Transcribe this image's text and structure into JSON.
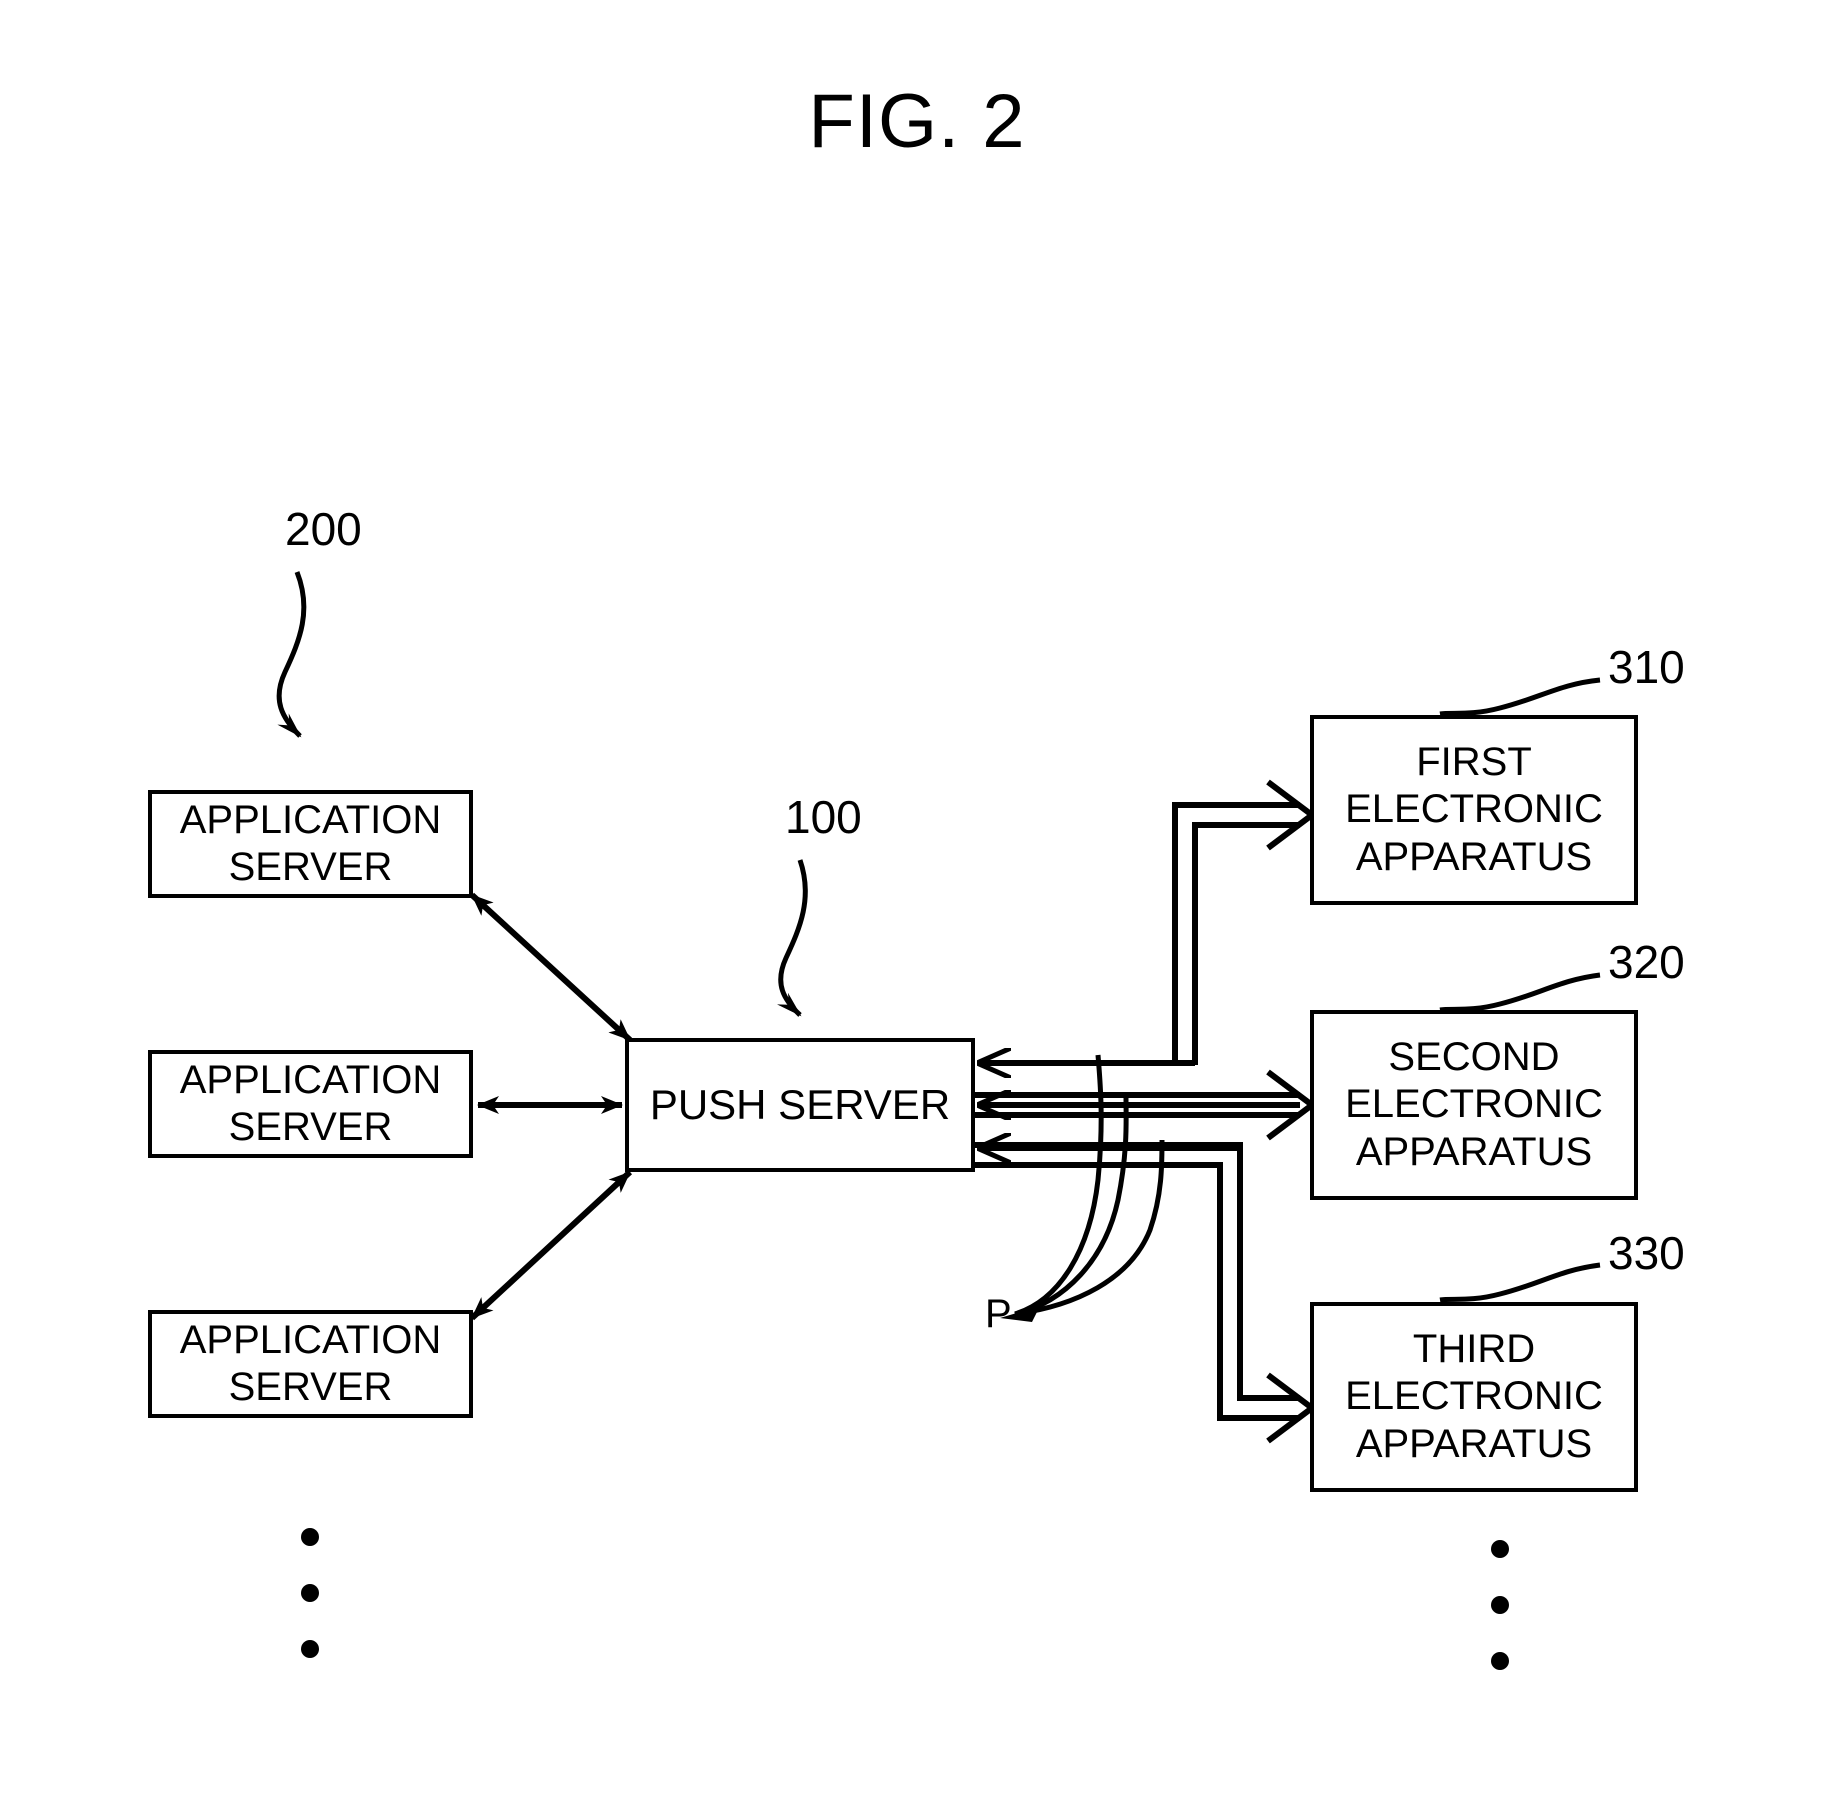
{
  "figure": {
    "title": "FIG. 2"
  },
  "nodes": {
    "application_servers": [
      {
        "line1": "APPLICATION",
        "line2": "SERVER"
      },
      {
        "line1": "APPLICATION",
        "line2": "SERVER"
      },
      {
        "line1": "APPLICATION",
        "line2": "SERVER"
      }
    ],
    "push_server": {
      "label": "PUSH SERVER"
    },
    "electronic_apparatuses": [
      {
        "line1": "FIRST",
        "line2": "ELECTRONIC",
        "line3": "APPARATUS"
      },
      {
        "line1": "SECOND",
        "line2": "ELECTRONIC",
        "line3": "APPARATUS"
      },
      {
        "line1": "THIRD",
        "line2": "ELECTRONIC",
        "line3": "APPARATUS"
      }
    ]
  },
  "reference_numerals": {
    "application_server_group": "200",
    "push_server": "100",
    "first_electronic_apparatus": "310",
    "second_electronic_apparatus": "320",
    "third_electronic_apparatus": "330",
    "push_message": "P"
  },
  "style": {
    "stroke": "#000000",
    "background": "#ffffff"
  }
}
